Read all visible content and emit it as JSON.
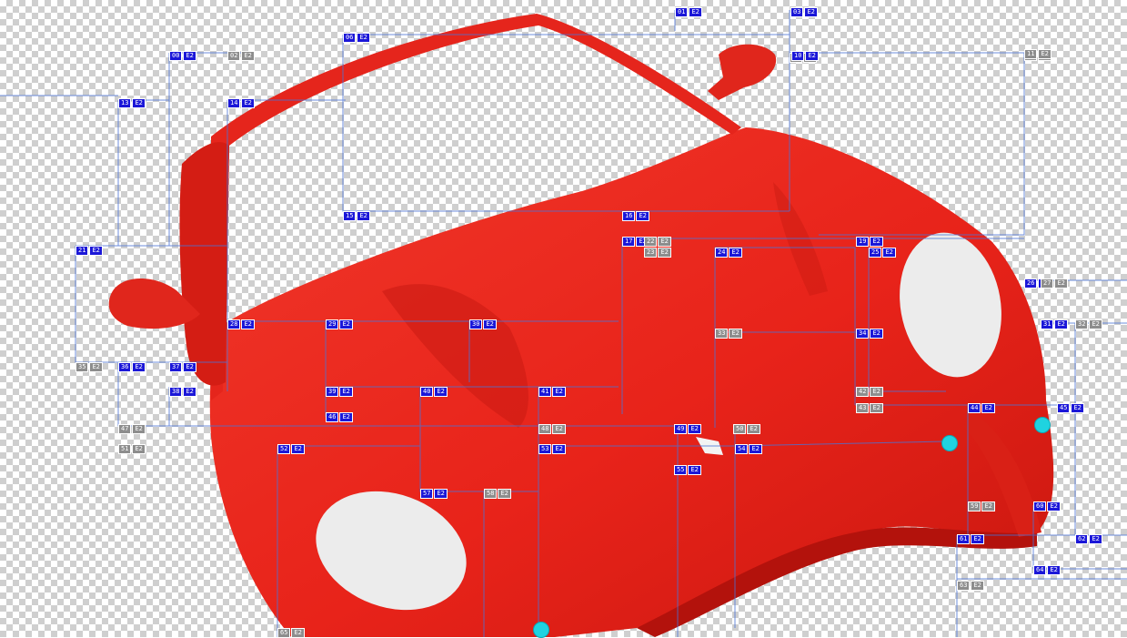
{
  "colors": {
    "car_body": "#e8231a",
    "car_shadow": "#b9140e",
    "guide_line": "#4a73d6",
    "tag_blue": "#1b17d8",
    "tag_gray": "#8d8d8d",
    "handle": "#1fd3e0"
  },
  "tags": [
    {
      "id": "00",
      "mark": "E2",
      "style": "blue"
    },
    {
      "id": "01",
      "mark": "E2",
      "style": "blue"
    },
    {
      "id": "02",
      "mark": "E2",
      "style": "gray"
    },
    {
      "id": "03",
      "mark": "E2",
      "style": "blue"
    },
    {
      "id": "04",
      "mark": "E2",
      "style": "gray"
    },
    {
      "id": "05",
      "mark": "E2",
      "style": "gray"
    },
    {
      "id": "06",
      "mark": "E2",
      "style": "blue"
    },
    {
      "id": "10",
      "mark": "E2",
      "style": "blue"
    },
    {
      "id": "11",
      "mark": "E2",
      "style": "gray"
    },
    {
      "id": "13",
      "mark": "E2",
      "style": "blue"
    },
    {
      "id": "14",
      "mark": "E2",
      "style": "blue"
    },
    {
      "id": "15",
      "mark": "E2",
      "style": "blue"
    },
    {
      "id": "16",
      "mark": "E2",
      "style": "blue"
    },
    {
      "id": "17",
      "mark": "E2",
      "style": "blue"
    },
    {
      "id": "19",
      "mark": "E2",
      "style": "blue"
    },
    {
      "id": "21",
      "mark": "E2",
      "style": "blue"
    },
    {
      "id": "22",
      "mark": "E2",
      "style": "gray"
    },
    {
      "id": "23",
      "mark": "E2",
      "style": "gray"
    },
    {
      "id": "24",
      "mark": "E2",
      "style": "blue"
    },
    {
      "id": "25",
      "mark": "E2",
      "style": "blue"
    },
    {
      "id": "26",
      "mark": "E2",
      "style": "blue"
    },
    {
      "id": "27",
      "mark": "E2",
      "style": "gray"
    },
    {
      "id": "28",
      "mark": "E2",
      "style": "blue"
    },
    {
      "id": "29",
      "mark": "E2",
      "style": "blue"
    },
    {
      "id": "30",
      "mark": "E2",
      "style": "blue"
    },
    {
      "id": "31",
      "mark": "E2",
      "style": "blue"
    },
    {
      "id": "32",
      "mark": "E2",
      "style": "gray"
    },
    {
      "id": "33",
      "mark": "E2",
      "style": "gray"
    },
    {
      "id": "34",
      "mark": "E2",
      "style": "blue"
    },
    {
      "id": "35",
      "mark": "E2",
      "style": "gray"
    },
    {
      "id": "36",
      "mark": "E2",
      "style": "blue"
    },
    {
      "id": "37",
      "mark": "E2",
      "style": "blue"
    },
    {
      "id": "38",
      "mark": "E2",
      "style": "blue"
    },
    {
      "id": "39",
      "mark": "E2",
      "style": "blue"
    },
    {
      "id": "40",
      "mark": "E2",
      "style": "blue"
    },
    {
      "id": "41",
      "mark": "E2",
      "style": "blue"
    },
    {
      "id": "42",
      "mark": "E2",
      "style": "gray"
    },
    {
      "id": "43",
      "mark": "E2",
      "style": "gray"
    },
    {
      "id": "44",
      "mark": "E2",
      "style": "blue"
    },
    {
      "id": "45",
      "mark": "E2",
      "style": "blue"
    },
    {
      "id": "46",
      "mark": "E2",
      "style": "blue"
    },
    {
      "id": "47",
      "mark": "E2",
      "style": "gray"
    },
    {
      "id": "48",
      "mark": "E2",
      "style": "gray"
    },
    {
      "id": "49",
      "mark": "E2",
      "style": "blue"
    },
    {
      "id": "50",
      "mark": "E2",
      "style": "gray"
    },
    {
      "id": "51",
      "mark": "E2",
      "style": "gray"
    },
    {
      "id": "52",
      "mark": "E2",
      "style": "blue"
    },
    {
      "id": "53",
      "mark": "E2",
      "style": "blue"
    },
    {
      "id": "54",
      "mark": "E2",
      "style": "blue"
    },
    {
      "id": "55",
      "mark": "E2",
      "style": "blue"
    },
    {
      "id": "57",
      "mark": "E2",
      "style": "blue"
    },
    {
      "id": "58",
      "mark": "E2",
      "style": "gray"
    },
    {
      "id": "59",
      "mark": "E2",
      "style": "gray"
    },
    {
      "id": "60",
      "mark": "E2",
      "style": "blue"
    },
    {
      "id": "61",
      "mark": "E2",
      "style": "blue"
    },
    {
      "id": "62",
      "mark": "E2",
      "style": "blue"
    },
    {
      "id": "63",
      "mark": "E2",
      "style": "gray"
    },
    {
      "id": "64",
      "mark": "E2",
      "style": "blue"
    },
    {
      "id": "65",
      "mark": "E2",
      "style": "gray"
    }
  ],
  "handles": [
    {
      "name": "handle-bumper-left"
    },
    {
      "name": "handle-bumper-right"
    },
    {
      "name": "handle-bottom"
    }
  ]
}
